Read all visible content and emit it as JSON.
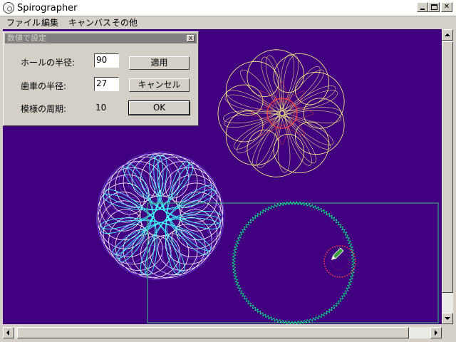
{
  "window": {
    "title": "Spirographer"
  },
  "menu": {
    "items": [
      "ファイル",
      "編集",
      "キャンバス",
      "その他"
    ]
  },
  "dialog": {
    "title": "数値で設定",
    "close_glyph": "x",
    "hole_radius": {
      "label": "ホールの半径:",
      "value": "90"
    },
    "gear_radius": {
      "label": "歯車の半径:",
      "value": "27"
    },
    "period": {
      "label": "模様の周期:",
      "value": "10"
    },
    "apply_label": "適用",
    "cancel_label": "キャンセル",
    "ok_label": "OK"
  },
  "canvas": {
    "background": "#400080",
    "colors": {
      "yellow": "#ffff80",
      "red": "#ff4040",
      "white": "#ffffff",
      "cyan": "#40ffff",
      "violet": "#8060ff",
      "gear_green": "#00ff80",
      "frame": "#40c080"
    }
  }
}
